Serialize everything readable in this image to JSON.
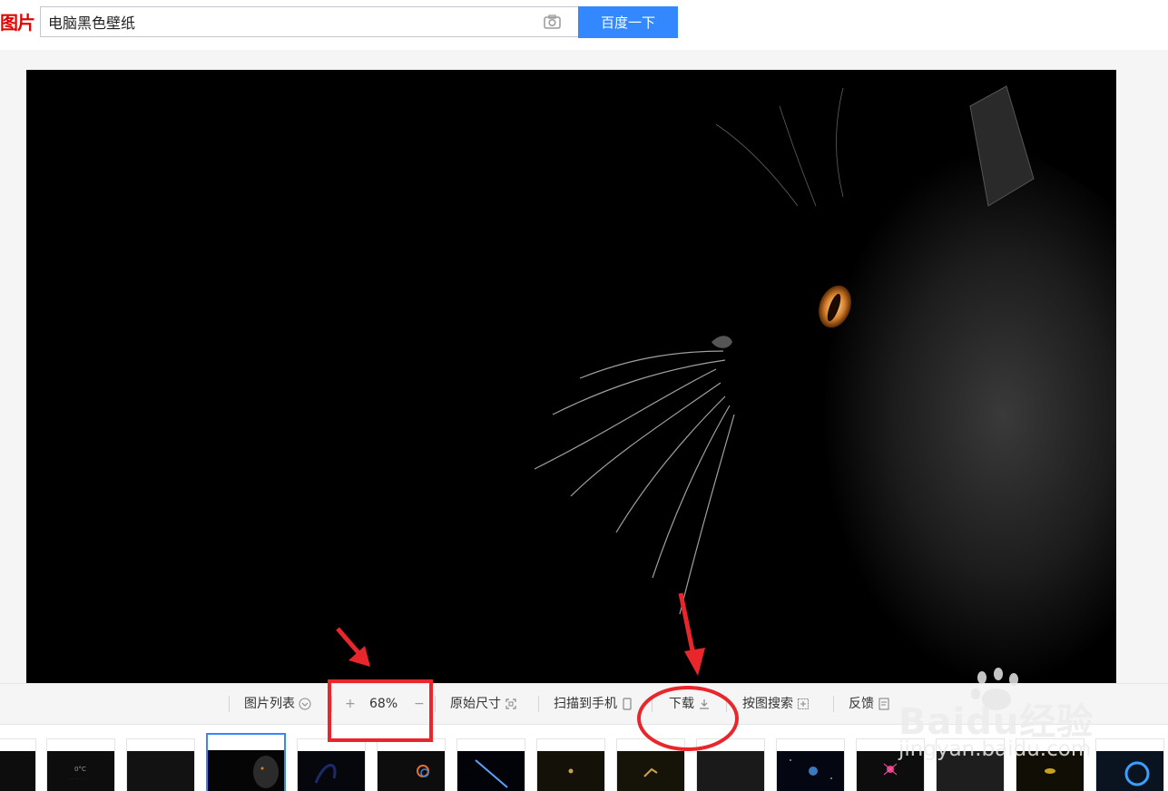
{
  "header": {
    "logo_text": "图片",
    "search_value": "电脑黑色壁纸",
    "search_button": "百度一下",
    "camera_icon": "camera-icon"
  },
  "viewer": {
    "image_subject": "black cat profile on black background"
  },
  "toolbar": {
    "list_label": "图片列表",
    "zoom_in": "+",
    "zoom_value": "68%",
    "zoom_out": "−",
    "original_size": "原始尺寸",
    "scan_to_phone": "扫描到手机",
    "download": "下载",
    "search_by_image": "按图搜索",
    "feedback": "反馈"
  },
  "watermark": {
    "brand": "Baidu经验",
    "url": "jingyan.baidu.com"
  },
  "colors": {
    "logo_red": "#e10601",
    "search_blue": "#3388ff",
    "annotation_red": "#e8262b"
  }
}
